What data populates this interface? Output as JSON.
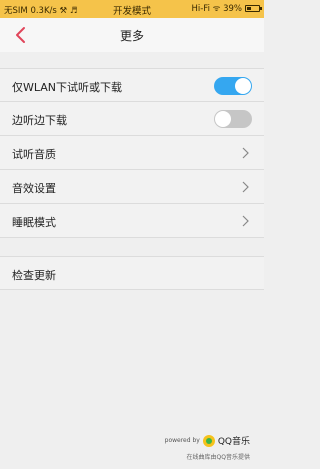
{
  "statusbar": {
    "left": "无SIM 0.3K/s ⚒ ♬",
    "center": "开发模式",
    "right_text": "Hi-Fi ᯤ 39%",
    "battery_percent": 39
  },
  "header": {
    "title": "更多"
  },
  "settings": {
    "wlan_only": {
      "label": "仅WLAN下试听或下载",
      "enabled": true
    },
    "download_while_listening": {
      "label": "边听边下载",
      "enabled": false
    },
    "audio_quality": {
      "label": "试听音质"
    },
    "sound_effects": {
      "label": "音效设置"
    },
    "sleep_mode": {
      "label": "睡眠模式"
    },
    "check_update": {
      "label": "检查更新"
    }
  },
  "footer": {
    "powered_by": "powered by",
    "brand": "QQ音乐",
    "provided": "在线曲库由QQ音乐提供"
  },
  "colors": {
    "statusbar": "#f5c34a",
    "accent_back": "#e0455a",
    "toggle_on": "#35a7f0",
    "toggle_off": "#c6c6c6"
  }
}
